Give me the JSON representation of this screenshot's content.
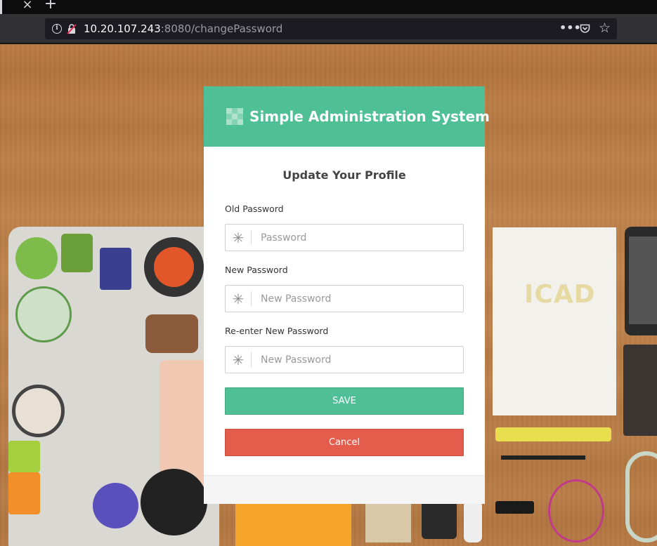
{
  "browser": {
    "tab_close_glyph": "×",
    "new_tab_glyph": "+",
    "url_host": "10.20.107.243",
    "url_rest": ":8080/changePassword",
    "more_glyph": "•••",
    "star_glyph": "☆"
  },
  "header": {
    "title": "Simple Administration System",
    "bg_color": "#4fc096"
  },
  "form": {
    "title": "Update Your Profile",
    "fields": [
      {
        "label": "Old Password",
        "placeholder": "Password"
      },
      {
        "label": "New Password",
        "placeholder": "New Password"
      },
      {
        "label": "Re-enter New Password",
        "placeholder": "New Password"
      }
    ],
    "field_icon": "✳",
    "save_label": "SAVE",
    "cancel_label": "Cancel",
    "save_color": "#4fc096",
    "cancel_color": "#e45c4c"
  },
  "background": {
    "notebook_logo": "ICAD"
  }
}
